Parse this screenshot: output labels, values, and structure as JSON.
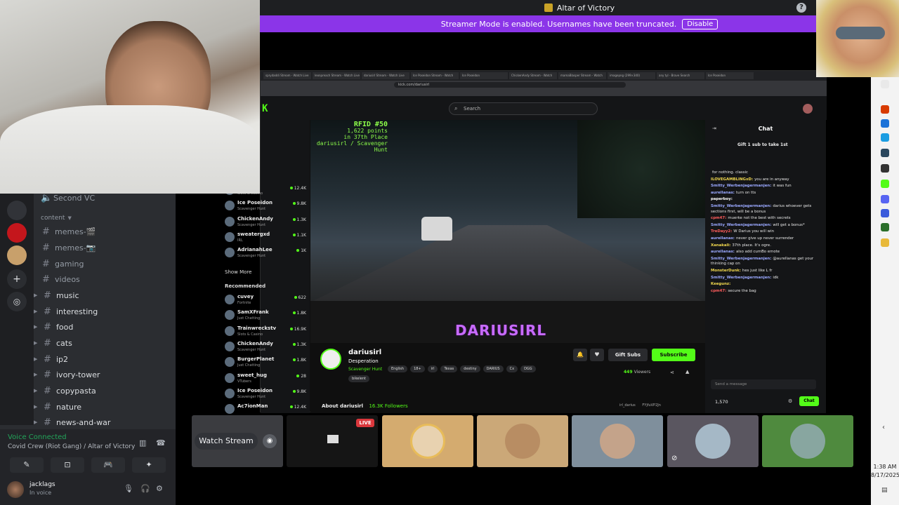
{
  "window": {
    "title": "Altar of Victory",
    "help_icon": "?"
  },
  "banner": {
    "text": "Streamer Mode is enabled. Usernames have been truncated.",
    "button": "Disable"
  },
  "discord": {
    "voice_channel_above": "Second VC",
    "category": "content",
    "channels": [
      {
        "name": "memes-🎬",
        "muted": true
      },
      {
        "name": "memes-📷",
        "muted": true
      },
      {
        "name": "gaming",
        "muted": true
      },
      {
        "name": "videos",
        "muted": true
      },
      {
        "name": "music",
        "muted": false
      },
      {
        "name": "interesting",
        "muted": false
      },
      {
        "name": "food",
        "muted": false
      },
      {
        "name": "cats",
        "muted": false
      },
      {
        "name": "ip2",
        "muted": false
      },
      {
        "name": "ivory-tower",
        "muted": false
      },
      {
        "name": "copypasta",
        "muted": false
      },
      {
        "name": "nature",
        "muted": false
      },
      {
        "name": "news-and-war",
        "muted": false
      }
    ],
    "voice": {
      "status": "Voice Connected",
      "location": "Covid Crew (Riot Gang) / Altar of Victory",
      "buttons": [
        "✎",
        "⊡",
        "🎮",
        "✦"
      ]
    },
    "user": {
      "name": "jacklags",
      "status": "In voice"
    },
    "watch_stream": "Watch Stream",
    "live_badge": "LIVE"
  },
  "browser": {
    "tabs": [
      "sprydaddi Stream - Watch Live",
      "leonpreach Stream - Watch Live",
      "dariusirl Stream - Watch Live",
      "Ice Poseidon Stream - Watch",
      "Ice Poseidon",
      "ChickenAndy Stream - Watch",
      "mamaBlasper Stream - Watch",
      "imagepng (299×340)",
      "any tyl - Brave Search",
      "Ice Poseidon"
    ],
    "url": "kick.com/dariusirl"
  },
  "kick": {
    "search_placeholder": "Search",
    "sidebar": {
      "following": [
        {
          "name": "an",
          "category": "Slots & Casino",
          "viewers": "12.4K"
        },
        {
          "name": "Ice Poseidon",
          "category": "Scavenger Hunt",
          "viewers": "9.8K"
        },
        {
          "name": "ChickenAndy",
          "category": "Scavenger Hunt",
          "viewers": "1.3K"
        },
        {
          "name": "sweatergxd",
          "category": "IRL",
          "viewers": "1.1K"
        },
        {
          "name": "AdrianahLee",
          "category": "Scavenger Hunt",
          "viewers": "1K"
        }
      ],
      "show_more": "Show More",
      "recommended_title": "Recommended",
      "recommended": [
        {
          "name": "cuvey",
          "category": "Fortnite",
          "viewers": "622"
        },
        {
          "name": "SamXFrank",
          "category": "Just Chatting",
          "viewers": "1.8K"
        },
        {
          "name": "Trainwreckstv",
          "category": "Slots & Casino",
          "viewers": "16.9K"
        },
        {
          "name": "ChickenAndy",
          "category": "Scavenger Hunt",
          "viewers": "1.3K"
        },
        {
          "name": "BurgerPlanet",
          "category": "Just Chatting",
          "viewers": "1.8K"
        },
        {
          "name": "sweet_hug",
          "category": "VTubers",
          "viewers": "28"
        },
        {
          "name": "Ice Poseidon",
          "category": "Scavenger Hunt",
          "viewers": "9.8K"
        },
        {
          "name": "Ac7ionMan",
          "category": "",
          "viewers": "12.4K"
        }
      ]
    },
    "overlay": {
      "rank": "RFID #50",
      "points": "1,622 points",
      "place": "in 37th Place",
      "sub": "dariusirl / Scavenger Hunt"
    },
    "watermark": "DARIUSIRL",
    "channel": {
      "name": "dariusirl",
      "title": "Desperation",
      "category": "Scavenger Hunt",
      "tags": [
        "English",
        "18+",
        "irl",
        "Texas",
        "destiny",
        "DARIUS",
        "Cx",
        "DGG"
      ],
      "tag_second_row": "bikelent",
      "gift_subs": "Gift Subs",
      "subscribe": "Subscribe",
      "viewers": "449",
      "viewers_label": "Viewers",
      "about": "About dariusirl",
      "followers": "16.3K Followers",
      "social_x": "irl_darius",
      "social_discord": "FYjfuVP2Jn"
    },
    "chat": {
      "title": "Chat",
      "gift_banner": "Gift 1 sub to take 1st",
      "messages": [
        {
          "user": "",
          "text": "for nothing. classic",
          "color": "#bbbbbb"
        },
        {
          "user": "ILOVEGAMBLINGxD:",
          "text": "you are in anyway",
          "color": "#f2d94e"
        },
        {
          "user": "Smitty_Werbenjagermanjen:",
          "text": "it was fun",
          "color": "#9aa8ff"
        },
        {
          "user": "aurellanas:",
          "text": "turn on tts",
          "color": "#9aa8ff"
        },
        {
          "user": "paperboy:",
          "text": "",
          "color": "#ffffff"
        },
        {
          "user": "Smitty_Werbenjagermanjen:",
          "text": "darius whoever gets sections first, will be a bonus",
          "color": "#9aa8ff"
        },
        {
          "user": "cpm47:",
          "text": "muerke not the best with secrets",
          "color": "#ff5c5c"
        },
        {
          "user": "Smitty_Werbenjagermanjen:",
          "text": "will get a bonus*",
          "color": "#9aa8ff"
        },
        {
          "user": "TreDayy2:",
          "text": "W Darius you will win",
          "color": "#ff5c5c"
        },
        {
          "user": "aurellanas:",
          "text": "never give up never surrender",
          "color": "#9aa8ff"
        },
        {
          "user": "Xanakali:",
          "text": "37th place. It's ogre.",
          "color": "#f2d94e"
        },
        {
          "user": "aurellanas:",
          "text": "also add cumBo emote",
          "color": "#9aa8ff"
        },
        {
          "user": "Smitty_Werbenjagermanjen:",
          "text": "@aurellanas get your thinking cap on",
          "color": "#9aa8ff"
        },
        {
          "user": "MonsterDunk:",
          "text": "hes just like L fr",
          "color": "#f2d94e"
        },
        {
          "user": "Smitty_Werbenjagermanjen:",
          "text": "idk",
          "color": "#9aa8ff"
        },
        {
          "user": "Keegunz:",
          "text": "",
          "color": "#f2d94e"
        },
        {
          "user": "cpm47:",
          "text": "secure the bag",
          "color": "#ff5c5c"
        }
      ],
      "input_placeholder": "Send a message",
      "points": "1,570",
      "chat_button": "Chat"
    }
  },
  "clock": {
    "time": "1:38 AM",
    "date": "8/17/2025"
  },
  "colors": {
    "kick_green": "#53fc18",
    "discord_purple": "#8b35e8",
    "voice_green": "#23a55a"
  }
}
